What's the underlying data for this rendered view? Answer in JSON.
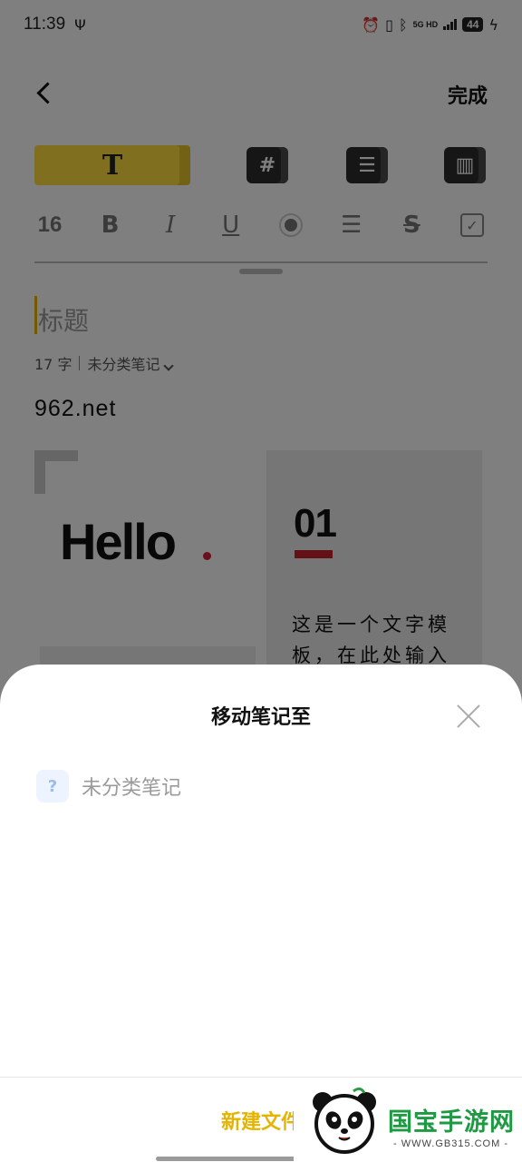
{
  "status_bar": {
    "time": "11:39",
    "network": "5G HD",
    "battery": "44"
  },
  "nav": {
    "done_label": "完成"
  },
  "toolbar": {
    "font_size": "16",
    "bold": "B",
    "italic": "I",
    "underline": "U",
    "strike": "S",
    "template_text": "T",
    "template_hash": "#"
  },
  "editor": {
    "title_placeholder": "标题",
    "word_count": "17 字",
    "category": "未分类笔记",
    "body": "962.net"
  },
  "template_preview": {
    "hello": "Hello",
    "number": "01",
    "line1": "这是一个文字模",
    "line2": "板，在此处输入"
  },
  "sheet": {
    "title": "移动笔记至",
    "folders": [
      {
        "icon": "?",
        "label": "未分类笔记"
      }
    ],
    "new_folder_label": "新建文件"
  },
  "watermark": {
    "title": "国宝手游网",
    "url": "- WWW.GB315.COM -"
  },
  "colors": {
    "accent_yellow": "#ffde3d",
    "new_folder_text": "#e4b400",
    "red_bar": "#c8202f",
    "watermark_green": "#1e9a43"
  }
}
